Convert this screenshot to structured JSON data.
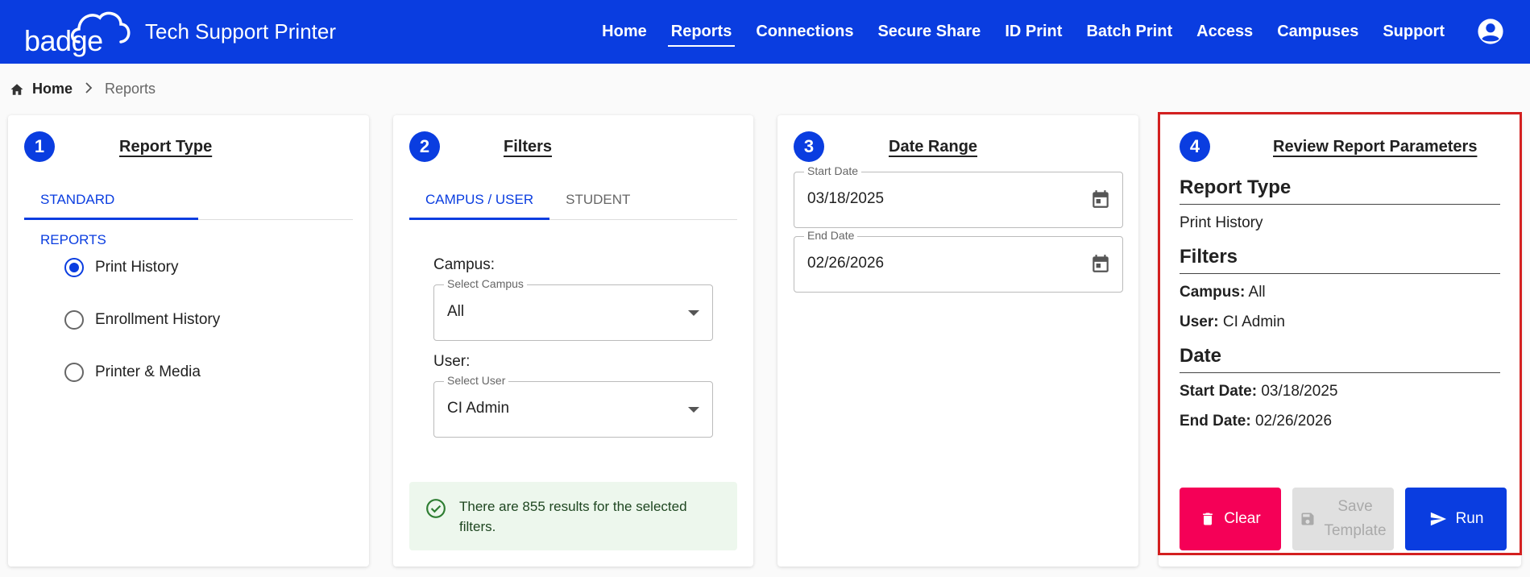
{
  "header": {
    "logo_text": "badge",
    "app_title": "Tech Support Printer",
    "nav": [
      {
        "label": "Home",
        "active": false
      },
      {
        "label": "Reports",
        "active": true
      },
      {
        "label": "Connections",
        "active": false
      },
      {
        "label": "Secure Share",
        "active": false
      },
      {
        "label": "ID Print",
        "active": false
      },
      {
        "label": "Batch Print",
        "active": false
      },
      {
        "label": "Access",
        "active": false
      },
      {
        "label": "Campuses",
        "active": false
      },
      {
        "label": "Support",
        "active": false
      }
    ],
    "brand_color": "#0a3de0"
  },
  "breadcrumb": {
    "home": "Home",
    "current": "Reports"
  },
  "report_type": {
    "step": "1",
    "title": "Report Type",
    "tab": "STANDARD REPORTS",
    "options": [
      {
        "label": "Print History",
        "checked": true
      },
      {
        "label": "Enrollment History",
        "checked": false
      },
      {
        "label": "Printer & Media",
        "checked": false
      }
    ]
  },
  "filters": {
    "step": "2",
    "title": "Filters",
    "tabs": [
      "CAMPUS / USER",
      "STUDENT"
    ],
    "campus_label": "Campus:",
    "campus_legend": "Select Campus",
    "campus_value": "All",
    "user_label": "User:",
    "user_legend": "Select User",
    "user_value": "CI Admin",
    "alert_text": "There are 855 results for the selected filters."
  },
  "date_range": {
    "step": "3",
    "title": "Date Range",
    "start_legend": "Start Date",
    "start_value": "03/18/2025",
    "end_legend": "End Date",
    "end_value": "02/26/2026"
  },
  "review": {
    "step": "4",
    "title": "Review Report Parameters",
    "report_type_head": "Report Type",
    "report_type_value": "Print History",
    "filters_head": "Filters",
    "campus_key": "Campus:",
    "campus_value": "All",
    "user_key": "User:",
    "user_value": "CI Admin",
    "date_head": "Date",
    "start_key": "Start Date:",
    "start_value": "03/18/2025",
    "end_key": "End Date:",
    "end_value": "02/26/2026",
    "clear_label": "Clear",
    "save_label_1": "Save",
    "save_label_2": "Template",
    "run_label": "Run"
  }
}
